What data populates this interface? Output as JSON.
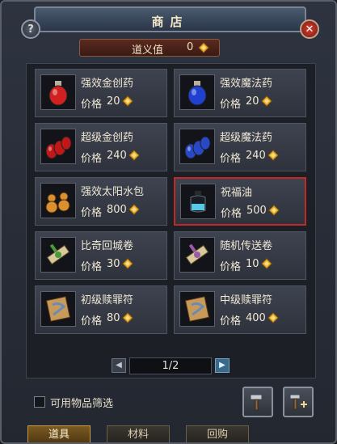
{
  "window": {
    "title": "商店"
  },
  "justice": {
    "label": "道义值",
    "value": "0",
    "icon": "gold-ingot-icon"
  },
  "price_label": "价格",
  "items": [
    {
      "name": "强效金创药",
      "price": "20",
      "icon": "red-potion-icon",
      "color": "#d02020"
    },
    {
      "name": "强效魔法药",
      "price": "20",
      "icon": "blue-potion-icon",
      "color": "#2040d0"
    },
    {
      "name": "超级金创药",
      "price": "240",
      "icon": "red-potions-stack-icon",
      "color": "#c01818"
    },
    {
      "name": "超级魔法药",
      "price": "240",
      "icon": "blue-potions-stack-icon",
      "color": "#2848c8"
    },
    {
      "name": "强效太阳水包",
      "price": "800",
      "icon": "gourd-bottles-icon",
      "color": "#d89030"
    },
    {
      "name": "祝福油",
      "price": "500",
      "icon": "blessing-oil-icon",
      "color": "#58c8e8",
      "selected": true
    },
    {
      "name": "比奇回城卷",
      "price": "30",
      "icon": "green-scroll-icon",
      "color": "#4a9a3a"
    },
    {
      "name": "随机传送卷",
      "price": "10",
      "icon": "purple-scroll-icon",
      "color": "#9a5aa8"
    },
    {
      "name": "初级赎罪符",
      "price": "80",
      "icon": "talisman-scroll-icon",
      "color": "#6a8ab8"
    },
    {
      "name": "中级赎罪符",
      "price": "400",
      "icon": "talisman-scroll-icon",
      "color": "#6a8ab8"
    }
  ],
  "pager": {
    "text": "1/2"
  },
  "filter": {
    "label": "可用物品筛选",
    "checked": false
  },
  "tabs": [
    {
      "label": "道具",
      "active": true
    },
    {
      "label": "材料",
      "active": false
    },
    {
      "label": "回购",
      "active": false
    }
  ],
  "colors": {
    "selected_border": "#c02a22",
    "coin": "#e8b030"
  }
}
